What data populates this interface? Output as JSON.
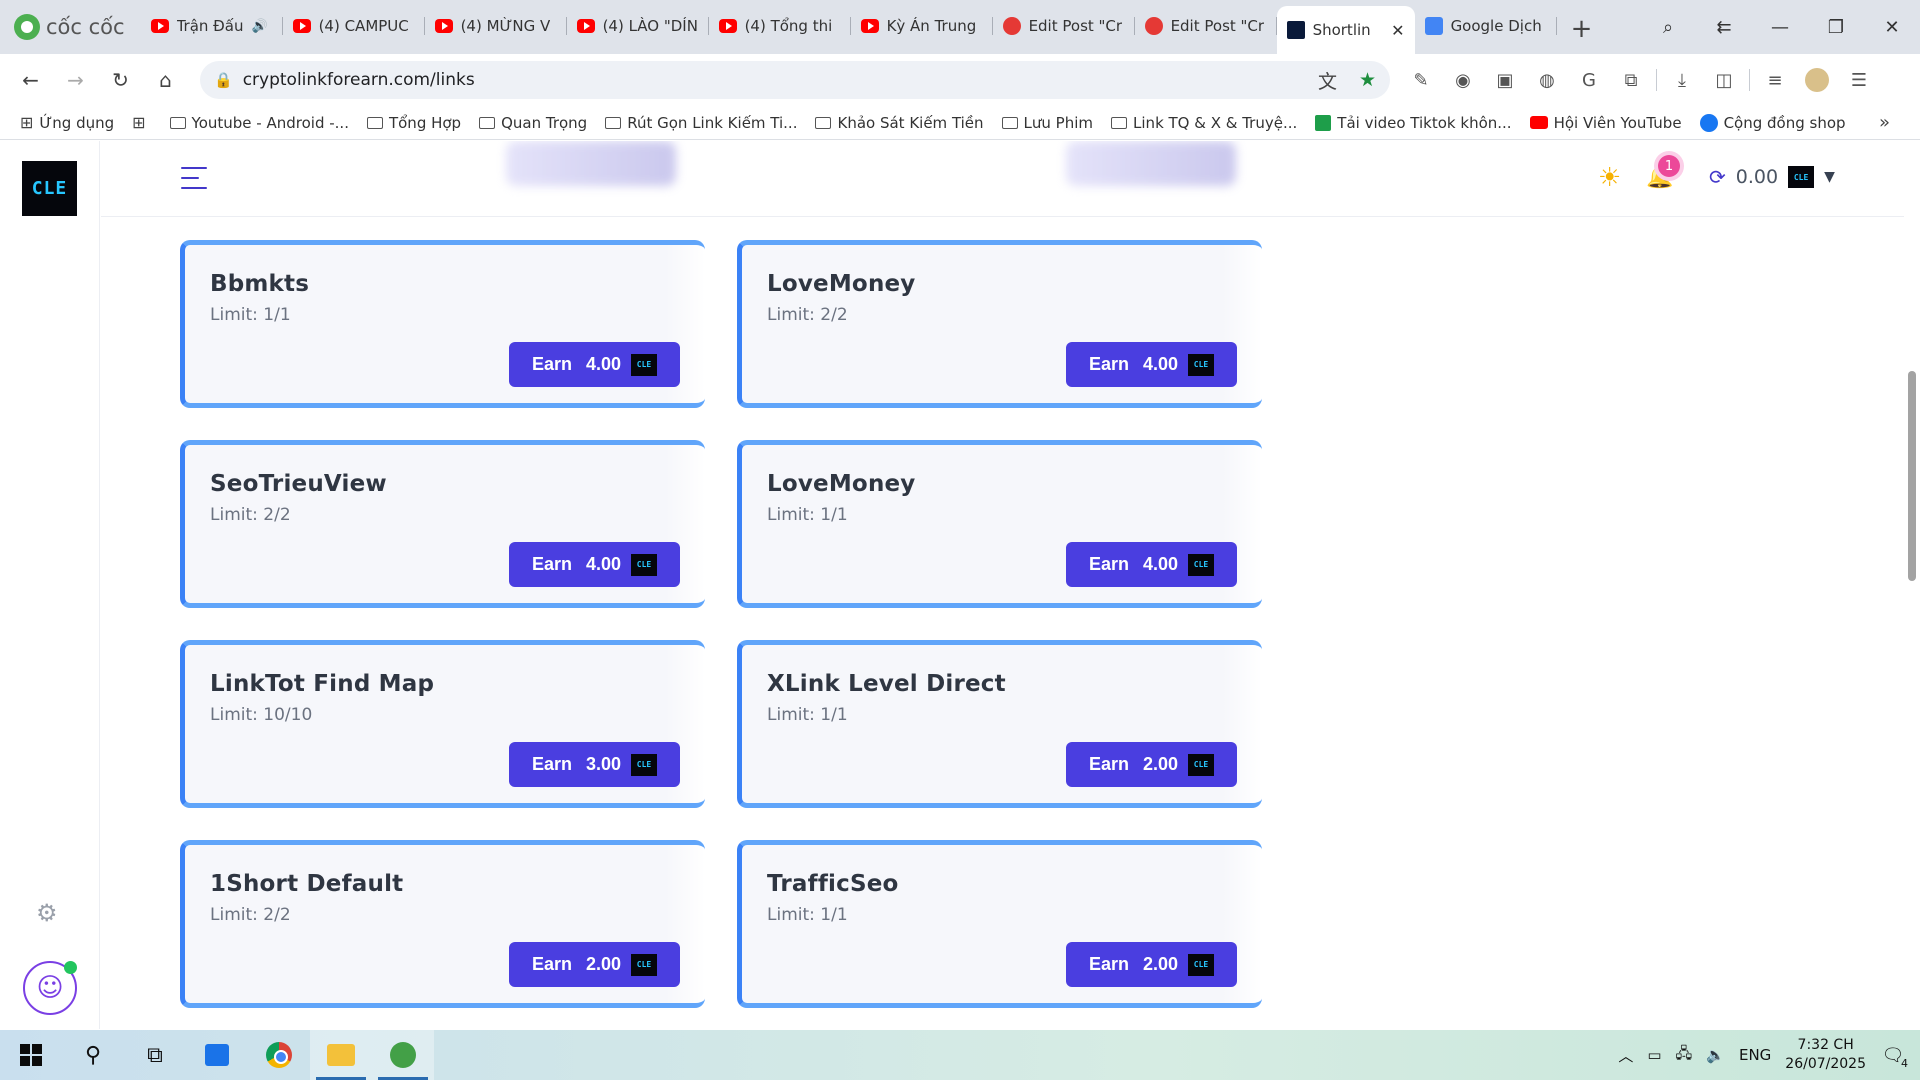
{
  "browser": {
    "brand": "cốc cốc",
    "tabs": [
      {
        "label": "Trận Đấu",
        "icon": "youtube-icon",
        "speaker": true
      },
      {
        "label": "(4) CAMPUC",
        "icon": "youtube-icon"
      },
      {
        "label": "(4) MỪNG V",
        "icon": "youtube-icon"
      },
      {
        "label": "(4) LÀO \"DÍN",
        "icon": "youtube-icon"
      },
      {
        "label": "(4) Tổng thi",
        "icon": "youtube-icon"
      },
      {
        "label": "Kỳ Án Trung",
        "icon": "youtube-icon"
      },
      {
        "label": "Edit Post \"Cr",
        "icon": "wp-icon"
      },
      {
        "label": "Edit Post \"Cr",
        "icon": "wp-icon"
      },
      {
        "label": "Shortlin",
        "icon": "cle-icon",
        "active": true
      },
      {
        "label": "Google Dịch",
        "icon": "google-translate-icon"
      }
    ],
    "new_tab": "+",
    "url": "cryptolinkforearn.com/links",
    "bookmarks": [
      {
        "label": "Ứng dụng",
        "icon": "apps-grid-icon"
      },
      {
        "label": "",
        "icon": "apps-grid-icon"
      },
      {
        "label": "Youtube - Android -...",
        "icon": "folder-icon"
      },
      {
        "label": "Tổng Hợp",
        "icon": "folder-icon"
      },
      {
        "label": "Quan Trọng",
        "icon": "folder-icon"
      },
      {
        "label": "Rút Gọn Link Kiếm Ti...",
        "icon": "folder-icon"
      },
      {
        "label": "Khảo Sát Kiếm Tiền",
        "icon": "folder-icon"
      },
      {
        "label": "Lưu Phim",
        "icon": "folder-icon"
      },
      {
        "label": "Link TQ & X & Truyệ...",
        "icon": "folder-icon"
      },
      {
        "label": "Tải video Tiktok khôn...",
        "icon": "download-icon"
      },
      {
        "label": "Hội Viên YouTube",
        "icon": "youtube-icon"
      },
      {
        "label": "Cộng đồng shop",
        "icon": "facebook-icon"
      }
    ]
  },
  "site": {
    "logo_text": "CLE",
    "notification_count": "1",
    "balance": "0.00",
    "links": [
      {
        "title": "Bbmkts",
        "limit": "Limit: 1/1",
        "earn_label": "Earn",
        "reward": "4.00"
      },
      {
        "title": "LoveMoney",
        "limit": "Limit: 2/2",
        "earn_label": "Earn",
        "reward": "4.00"
      },
      {
        "title": "SeoTrieuView",
        "limit": "Limit: 2/2",
        "earn_label": "Earn",
        "reward": "4.00"
      },
      {
        "title": "LoveMoney",
        "limit": "Limit: 1/1",
        "earn_label": "Earn",
        "reward": "4.00"
      },
      {
        "title": "LinkTot Find Map",
        "limit": "Limit: 10/10",
        "earn_label": "Earn",
        "reward": "3.00"
      },
      {
        "title": "XLink Level Direct",
        "limit": "Limit: 1/1",
        "earn_label": "Earn",
        "reward": "2.00"
      },
      {
        "title": "1Short Default",
        "limit": "Limit: 2/2",
        "earn_label": "Earn",
        "reward": "2.00"
      },
      {
        "title": "TrafficSeo",
        "limit": "Limit: 1/1",
        "earn_label": "Earn",
        "reward": "2.00"
      }
    ]
  },
  "taskbar": {
    "language": "ENG",
    "time": "7:32 CH",
    "date": "26/07/2025",
    "notification_count": "4"
  },
  "colors": {
    "earn_button": "#4a3ee0",
    "card_border": "#3b82f6",
    "accent": "#4338ca",
    "badge": "#ec4899"
  }
}
